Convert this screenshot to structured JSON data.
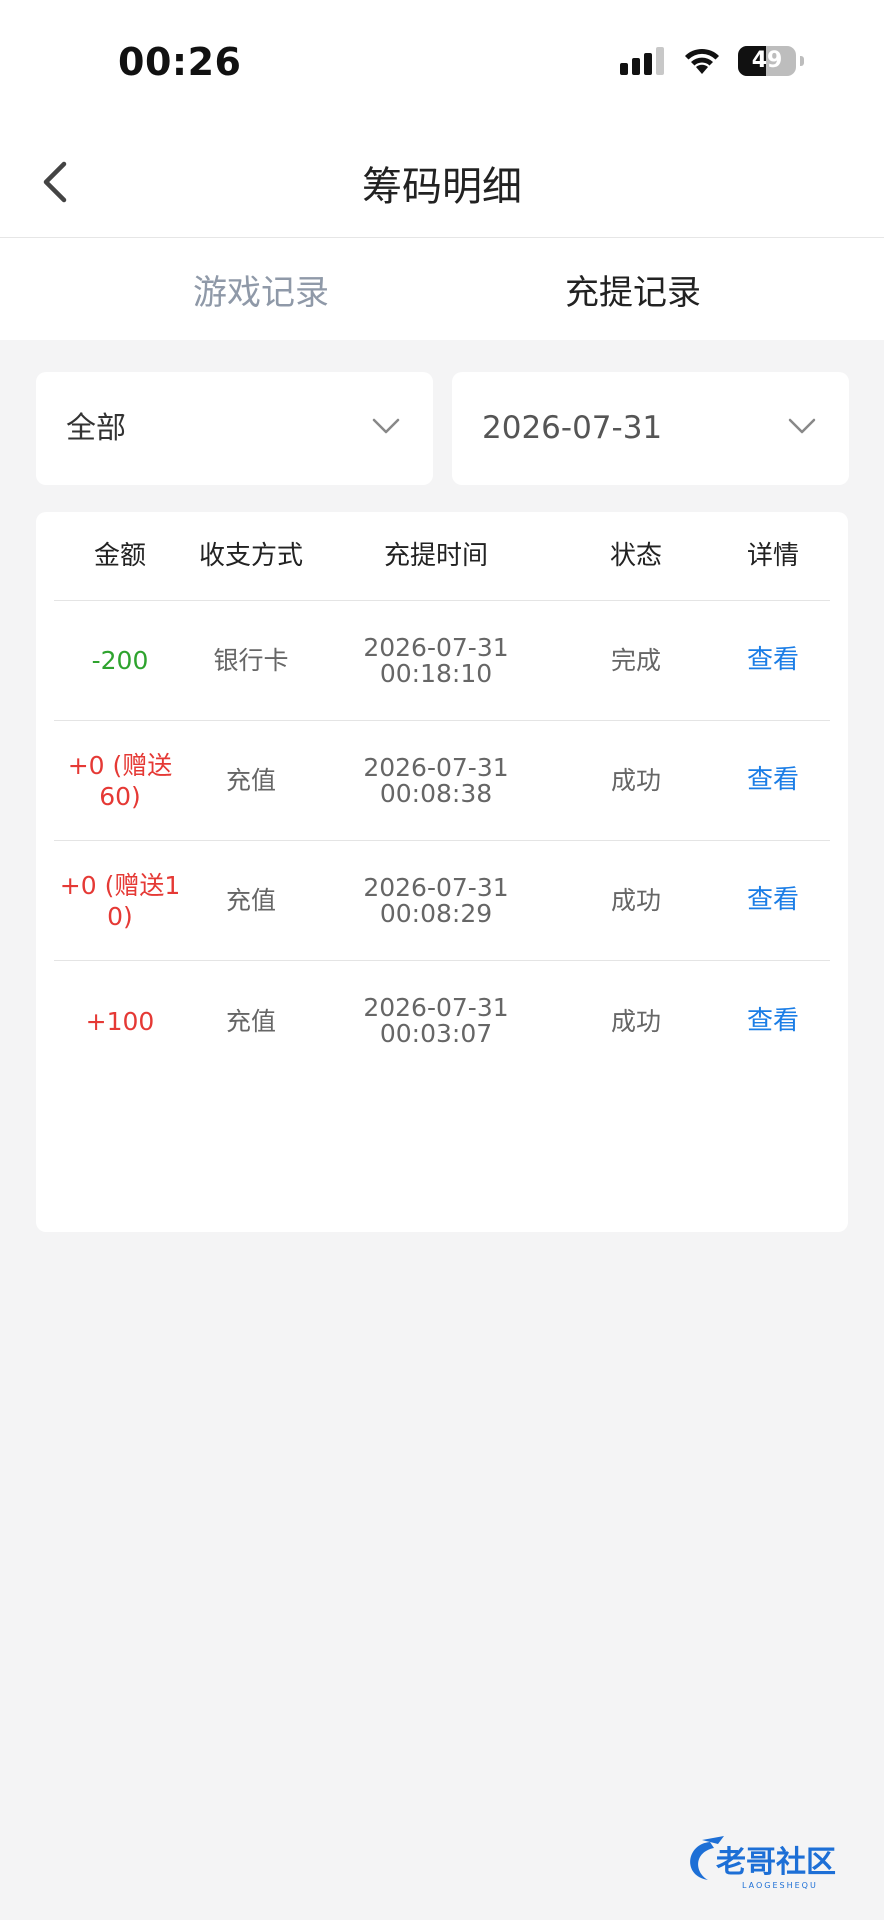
{
  "status_bar": {
    "time": "00:26",
    "battery": "49",
    "battery_level": 0.49
  },
  "nav": {
    "title": "筹码明细"
  },
  "tabs": [
    {
      "label": "游戏记录",
      "active": false
    },
    {
      "label": "充提记录",
      "active": true
    }
  ],
  "filters": {
    "type_selected": "全部",
    "date_selected": "2026-07-31"
  },
  "table": {
    "headers": [
      "金额",
      "收支方式",
      "充提时间",
      "状态",
      "详情"
    ],
    "rows": [
      {
        "amount_line1": "-200",
        "amount_line2": "",
        "amount_color": "#2ea32e",
        "method": "银行卡",
        "date": "2026-07-31",
        "time": "00:18:10",
        "status": "完成",
        "detail": "查看"
      },
      {
        "amount_line1": "+0 (赠送",
        "amount_line2": "60)",
        "amount_color": "#e53935",
        "method": "充值",
        "date": "2026-07-31",
        "time": "00:08:38",
        "status": "成功",
        "detail": "查看"
      },
      {
        "amount_line1": "+0 (赠送1",
        "amount_line2": "0)",
        "amount_color": "#e53935",
        "method": "充值",
        "date": "2026-07-31",
        "time": "00:08:29",
        "status": "成功",
        "detail": "查看"
      },
      {
        "amount_line1": "+100",
        "amount_line2": "",
        "amount_color": "#e53935",
        "method": "充值",
        "date": "2026-07-31",
        "time": "00:03:07",
        "status": "成功",
        "detail": "查看"
      }
    ]
  },
  "watermark": {
    "text": "老哥社区",
    "subtext": "LAOGESHEQU"
  },
  "icons": {
    "back": "chevron-left-icon",
    "dropdown": "chevron-down-icon",
    "signal": "signal-icon",
    "wifi": "wifi-icon",
    "battery": "battery-icon"
  }
}
